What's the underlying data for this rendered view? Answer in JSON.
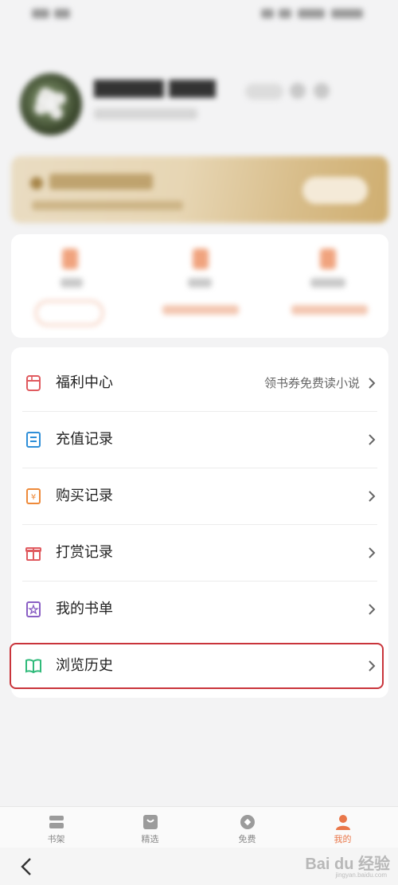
{
  "menu": {
    "items": [
      {
        "label": "福利中心",
        "hint": "领书券免费读小说",
        "icon": "gift-box-icon",
        "color": "#e05a5f"
      },
      {
        "label": "充值记录",
        "hint": "",
        "icon": "receipt-icon",
        "color": "#2f8fd8"
      },
      {
        "label": "购买记录",
        "hint": "",
        "icon": "purchase-icon",
        "color": "#ee8a3a"
      },
      {
        "label": "打赏记录",
        "hint": "",
        "icon": "gift-icon",
        "color": "#e05a5f"
      },
      {
        "label": "我的书单",
        "hint": "",
        "icon": "booklist-icon",
        "color": "#8a5fc4"
      },
      {
        "label": "浏览历史",
        "hint": "",
        "icon": "open-book-icon",
        "color": "#2fba7a"
      }
    ]
  },
  "tabs": [
    {
      "label": "书架",
      "icon": "bookshelf-icon",
      "active": false
    },
    {
      "label": "精选",
      "icon": "featured-icon",
      "active": false
    },
    {
      "label": "免费",
      "icon": "free-icon",
      "active": false
    },
    {
      "label": "我的",
      "icon": "profile-icon",
      "active": true
    }
  ],
  "watermark": {
    "text": "Bai du 经验",
    "sub": "jingyan.baidu.com"
  },
  "colors": {
    "accent": "#e9774a",
    "highlight_border": "#c9343b",
    "gold_card": "#d8bd8a"
  }
}
